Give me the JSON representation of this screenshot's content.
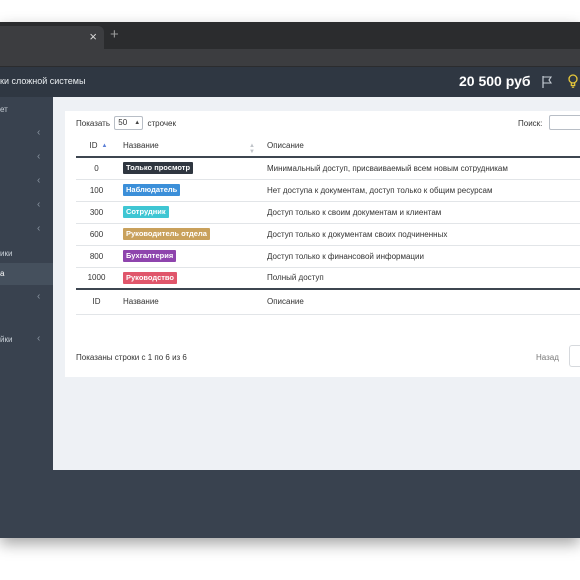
{
  "browser": {
    "tab_close": "×",
    "new_tab": "+"
  },
  "header": {
    "title": "ки сложной системы",
    "balance": "20 500 руб",
    "icons": [
      "flag-icon",
      "lightbulb-icon"
    ]
  },
  "sidebar": {
    "items": [
      {
        "label": "ет",
        "chevron": ""
      },
      {
        "label": "",
        "chevron": "‹"
      },
      {
        "label": "",
        "chevron": "‹"
      },
      {
        "label": "",
        "chevron": "‹"
      },
      {
        "label": "",
        "chevron": "‹"
      },
      {
        "label": "",
        "chevron": "‹"
      },
      {
        "label": "ики",
        "chevron": ""
      },
      {
        "label": "а",
        "chevron": ""
      },
      {
        "label": "",
        "chevron": "‹"
      },
      {
        "label": "",
        "chevron": ""
      },
      {
        "label": "йки",
        "chevron": "‹"
      }
    ]
  },
  "table_controls": {
    "show_label": "Показать",
    "show_value": "50",
    "show_suffix": "строчек",
    "search_label": "Поиск:",
    "search_value": ""
  },
  "table": {
    "columns": [
      "ID",
      "Название",
      "Описание"
    ],
    "rows": [
      {
        "id": "0",
        "name": "Только просмотр",
        "color": "#2f3640",
        "desc": "Минимальный доступ, присваиваемый всем новым сотрудникам"
      },
      {
        "id": "100",
        "name": "Наблюдатель",
        "color": "#3b8fd9",
        "desc": "Нет доступа к документам, доступ только к общим ресурсам"
      },
      {
        "id": "300",
        "name": "Сотрудник",
        "color": "#3fc6d3",
        "desc": "Доступ только к своим документам и клиентам"
      },
      {
        "id": "600",
        "name": "Руководитель отдела",
        "color": "#c9a15c",
        "desc": "Доступ только к документам своих подчиненных"
      },
      {
        "id": "800",
        "name": "Бухгалтерия",
        "color": "#8e44ad",
        "desc": "Доступ только к финансовой информации"
      },
      {
        "id": "1000",
        "name": "Руководство",
        "color": "#e0566b",
        "desc": "Полный доступ"
      }
    ],
    "footer_columns": [
      "ID",
      "Название",
      "Описание"
    ]
  },
  "pagination": {
    "info": "Показаны строки с 1 по 6 из 6",
    "prev": "Назад"
  }
}
